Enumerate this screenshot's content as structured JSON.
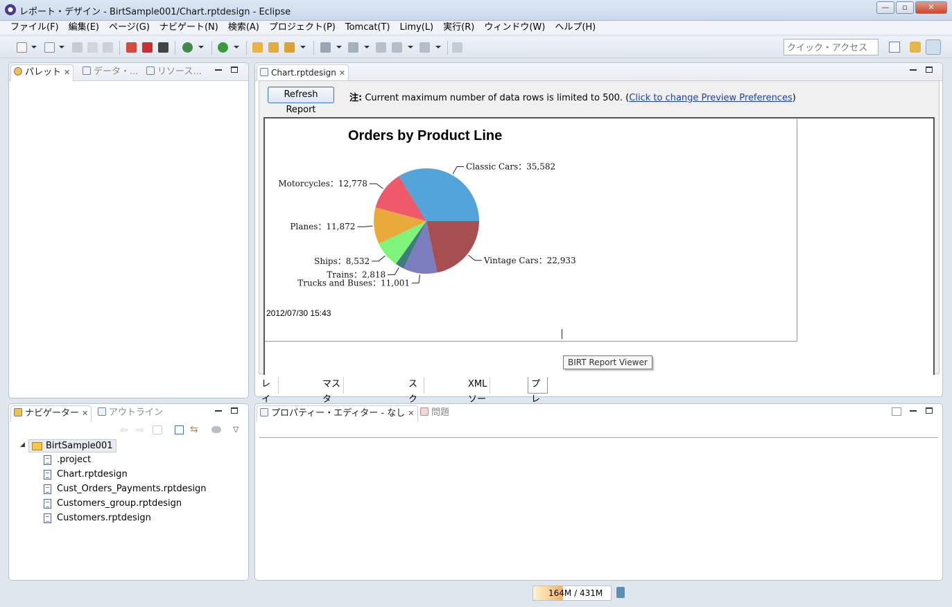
{
  "window": {
    "title": "レポート・デザイン - BirtSample001/Chart.rptdesign - Eclipse",
    "minimize": "—",
    "maximize": "▫",
    "close": "✕"
  },
  "menu": [
    "ファイル(F)",
    "編集(E)",
    "ページ(G)",
    "ナビゲート(N)",
    "検索(A)",
    "プロジェクト(P)",
    "Tomcat(T)",
    "Limy(L)",
    "実行(R)",
    "ウィンドウ(W)",
    "ヘルプ(H)"
  ],
  "quick_access": {
    "placeholder": "クイック・アクセス"
  },
  "palette_panel": {
    "tabs": [
      "パレット",
      "データ・...",
      "リソース..."
    ]
  },
  "editor": {
    "tab": "Chart.rptdesign",
    "refresh_label": "Refresh Report",
    "note_prefix": "注:",
    "note_text": " Current maximum number of data rows is limited to 500. (",
    "note_link": "Click to change Preview Preferences",
    "note_suffix": ")",
    "report_timestamp": "2012/07/30 15:43",
    "tooltip": "BIRT Report Viewer",
    "bottom_tabs": [
      "レイアウト(O)",
      "マスター・ページ(M)",
      "スクリプト(S)",
      "XML ソース(X)",
      "プレビュー(V)"
    ],
    "active_bottom_tab": 4
  },
  "chart_data": {
    "type": "pie",
    "title": "Orders by Product Line",
    "categories": [
      "Classic Cars",
      "Vintage Cars",
      "Trucks and Buses",
      "Trains",
      "Ships",
      "Planes",
      "Motorcycles"
    ],
    "values": [
      35582,
      22933,
      11001,
      2818,
      8532,
      11872,
      12778
    ],
    "labels": [
      "Classic Cars：35,582",
      "Vintage Cars：22,933",
      "Trucks and Buses：11,001",
      "Trains：2,818",
      "Ships：8,532",
      "Planes：11,872",
      "Motorcycles：12,778"
    ],
    "colors": [
      "#52a4d9",
      "#a54f51",
      "#7b7dbf",
      "#3d7d7d",
      "#7ef47a",
      "#e8aa3a",
      "#ef5a6a"
    ]
  },
  "navigator": {
    "tabs": [
      "ナビゲーター",
      "アウトライン"
    ],
    "project": "BirtSample001",
    "files": [
      ".project",
      "Chart.rptdesign",
      "Cust_Orders_Payments.rptdesign",
      "Customers_group.rptdesign",
      "Customers.rptdesign"
    ]
  },
  "properties_panel": {
    "tabs": [
      "プロパティー・エディター - なし",
      "問題"
    ]
  },
  "status": {
    "heap_used": "164M",
    "heap_total": "431M",
    "heap_sep": " / ",
    "heap_fraction": 0.38
  }
}
